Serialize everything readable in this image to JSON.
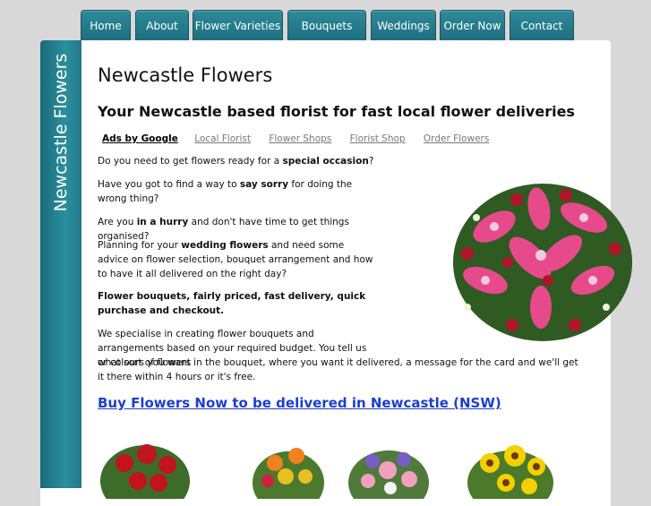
{
  "nav": {
    "tabs": [
      "Home",
      "About",
      "Flower Varieties",
      "Bouquets",
      "Weddings",
      "Order Now",
      "Contact"
    ]
  },
  "sidebar": {
    "title": "Newcastle Flowers"
  },
  "header": {
    "title": "Newcastle Flowers",
    "tagline": "Your Newcastle based florist for fast local flower deliveries"
  },
  "ads": {
    "label": "Ads by Google",
    "links": [
      "Local Florist",
      "Flower Shops",
      "Florist Shop",
      "Order Flowers"
    ]
  },
  "content": {
    "p1_pre": "Do you need to get flowers ready for a ",
    "p1_bold": "special occasion",
    "p1_post": "?",
    "p2_pre": "Have you got to find a way to ",
    "p2_bold": "say sorry",
    "p2_post": " for doing the wrong thing?",
    "p3_pre": "Are you ",
    "p3_bold": "in a hurry",
    "p3_post": " and don't have time to get things organised?",
    "p4_pre": "Planning for your ",
    "p4_bold": "wedding flowers",
    "p4_post": " and need some advice on flower selection, bouquet arrangement and how to have it all delivered on the right day?",
    "p5": "Flower bouquets, fairly priced, fast delivery, quick purchase and checkout.",
    "p6a": "We specialise in creating flower bouquets and arrangements based on your required budget. You tell us what sort of flowers",
    "p6b": "or colours you want in the bouquet, where you want it delivered, a message for the card and we'll get it there within 4 hours or it's free."
  },
  "buy_link": "Buy Flowers Now to be delivered in Newcastle (NSW)",
  "colors": {
    "nav_teal": "#1f6f7e",
    "link_blue": "#1a3fd0",
    "ads_grey": "#777777"
  }
}
